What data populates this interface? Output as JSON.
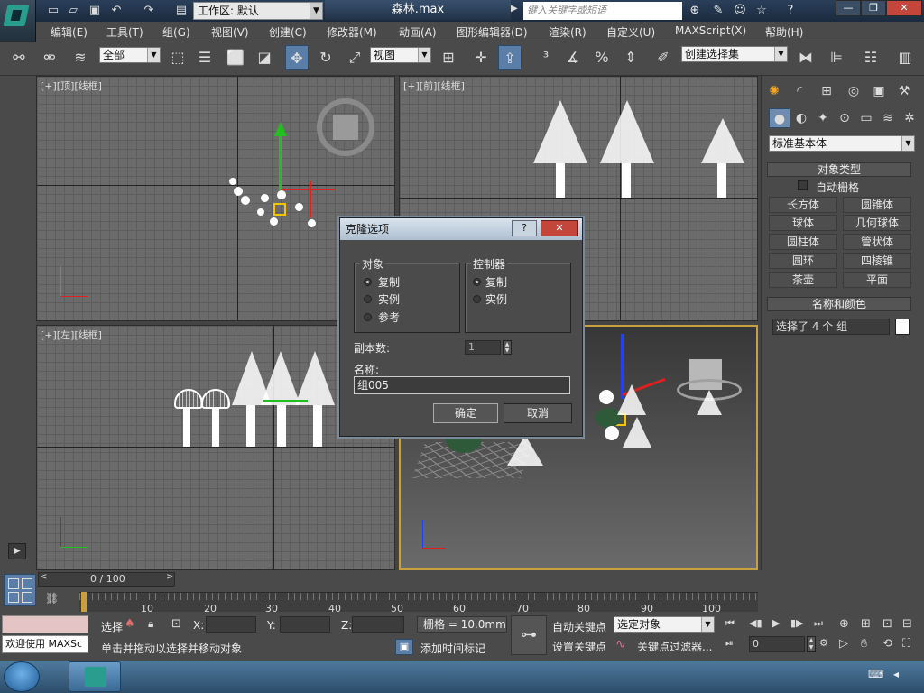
{
  "title_bar": {
    "workspace": "工作区: 默认",
    "document": "森林.max",
    "search_placeholder": "键入关键字或短语"
  },
  "menu": [
    "编辑(E)",
    "工具(T)",
    "组(G)",
    "视图(V)",
    "创建(C)",
    "修改器(M)",
    "动画(A)",
    "图形编辑器(D)",
    "渲染(R)",
    "自定义(U)",
    "MAXScript(X)",
    "帮助(H)"
  ],
  "toolbar": {
    "selection_filter": "全部",
    "ref_coord": "视图",
    "named_selection": "创建选择集"
  },
  "viewports": {
    "top": "[+][顶][线框]",
    "front": "[+][前][线框]",
    "left": "[+][左][线框]"
  },
  "command_panel": {
    "category": "标准基本体",
    "object_type_header": "对象类型",
    "autogrid": "自动栅格",
    "buttons": [
      "长方体",
      "圆锥体",
      "球体",
      "几何球体",
      "圆柱体",
      "管状体",
      "圆环",
      "四棱锥",
      "茶壶",
      "平面"
    ],
    "name_color_header": "名称和颜色",
    "name_value": "选择了 4 个 组"
  },
  "dialog": {
    "title": "克隆选项",
    "object_group": "对象",
    "object_options": [
      "复制",
      "实例",
      "参考"
    ],
    "controller_group": "控制器",
    "controller_options": [
      "复制",
      "实例"
    ],
    "copies_label": "副本数:",
    "copies_value": "1",
    "name_label": "名称:",
    "name_value": "组005",
    "ok": "确定",
    "cancel": "取消"
  },
  "timeline": {
    "frame": "0 / 100",
    "ticks": [
      "10",
      "20",
      "30",
      "40",
      "50",
      "60",
      "70",
      "80",
      "90",
      "100"
    ]
  },
  "status": {
    "welcome": "欢迎使用 MAXSc",
    "select_label": "选择",
    "x_label": "X:",
    "y_label": "Y:",
    "z_label": "Z:",
    "grid": "栅格 = 10.0mm",
    "prompt": "单击并拖动以选择并移动对象",
    "add_time_tag": "添加时间标记",
    "auto_key": "自动关键点",
    "set_key": "设置关键点",
    "key_mode": "选定对象",
    "key_filter": "关键点过滤器...",
    "frame_value": "0"
  },
  "colors": {
    "select_highlight": "#f5c400",
    "axis_x": "#e02020",
    "axis_y": "#20c020",
    "axis_z": "#2040ff"
  }
}
